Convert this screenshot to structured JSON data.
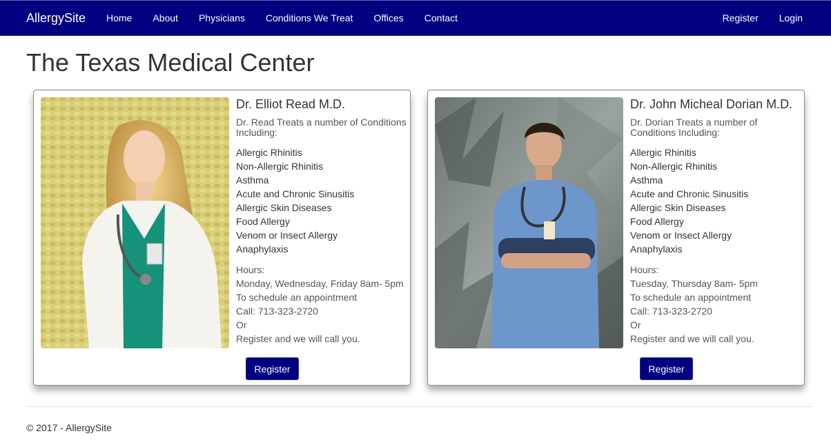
{
  "nav": {
    "brand": "AllergySite",
    "links": [
      "Home",
      "About",
      "Physicians",
      "Conditions We Treat",
      "Offices",
      "Contact"
    ],
    "right": [
      "Register",
      "Login"
    ]
  },
  "page": {
    "title": "The Texas Medical Center"
  },
  "doctors": [
    {
      "name": "Dr. Elliot Read M.D.",
      "intro": "Dr. Read Treats a number of Conditions Including:",
      "conditions": [
        "Allergic Rhinitis",
        "Non-Allergic Rhinitis",
        "Asthma",
        "Acute and Chronic Sinusitis",
        "Allergic Skin Diseases",
        "Food Allergy",
        "Venom or Insect Allergy",
        "Anaphylaxis"
      ],
      "hours_label": "Hours:",
      "hours": "Monday, Wednesday, Friday 8am- 5pm",
      "schedule": "To schedule an appointment",
      "call": "Call: 713-323-2720",
      "or": "Or",
      "register_text": "Register and we will call you.",
      "button": "Register"
    },
    {
      "name": "Dr. John Micheal Dorian M.D.",
      "intro": "Dr. Dorian Treats a number of Conditions Including:",
      "conditions": [
        "Allergic Rhinitis",
        "Non-Allergic Rhinitis",
        "Asthma",
        "Acute and Chronic Sinusitis",
        "Allergic Skin Diseases",
        "Food Allergy",
        "Venom or Insect Allergy",
        "Anaphylaxis"
      ],
      "hours_label": "Hours:",
      "hours": "Tuesday, Thursday 8am- 5pm",
      "schedule": "To schedule an appointment",
      "call": "Call: 713-323-2720",
      "or": "Or",
      "register_text": "Register and we will call you.",
      "button": "Register"
    }
  ],
  "footer": {
    "text": "© 2017 - AllergySite"
  },
  "colors": {
    "nav_bg": "#000080",
    "button_bg": "#000080",
    "text": "#333333"
  }
}
